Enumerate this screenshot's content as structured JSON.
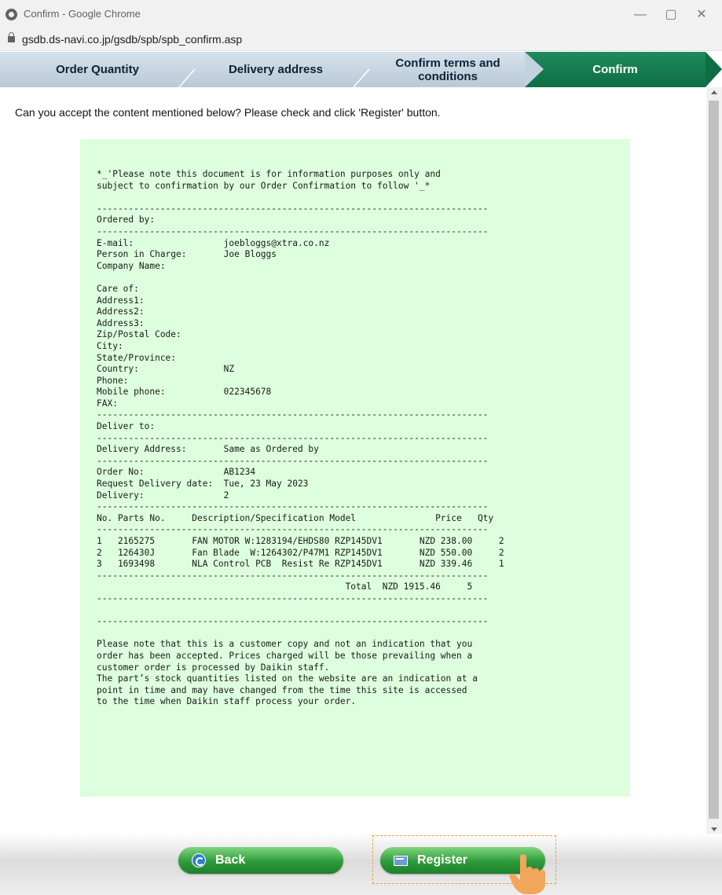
{
  "window": {
    "title": "Confirm - Google Chrome"
  },
  "address": {
    "url": "gsdb.ds-navi.co.jp/gsdb/spb/spb_confirm.asp"
  },
  "steps": [
    {
      "label": "Order Quantity"
    },
    {
      "label": "Delivery address"
    },
    {
      "label_line1": "Confirm terms and",
      "label_line2": "conditions"
    },
    {
      "label": "Confirm"
    }
  ],
  "page": {
    "prompt": "Can you accept the content mentioned below? Please check and click 'Register' button.",
    "document": "*_'Please note this document is for information purposes only and\nsubject to confirmation by our Order Confirmation to follow '_*\n\n--------------------------------------------------------------------------\nOrdered by:\n--------------------------------------------------------------------------\nE-mail:                 joebloggs@xtra.co.nz\nPerson in Charge:       Joe Bloggs\nCompany Name:\n\nCare of:\nAddress1:\nAddress2:\nAddress3:\nZip/Postal Code:\nCity:\nState/Province:\nCountry:                NZ\nPhone:\nMobile phone:           022345678\nFAX:\n--------------------------------------------------------------------------\nDeliver to:\n--------------------------------------------------------------------------\nDelivery Address:       Same as Ordered by\n--------------------------------------------------------------------------\nOrder No:               AB1234\nRequest Delivery date:  Tue, 23 May 2023\nDelivery:               2\n--------------------------------------------------------------------------\nNo. Parts No.     Description/Specification Model               Price   Qty\n--------------------------------------------------------------------------\n1   2165275       FAN MOTOR W:1283194/EHDS80 RZP145DV1       NZD 238.00     2\n2   126430J       Fan Blade  W:1264302/P47M1 RZP145DV1       NZD 550.00     2\n3   1693498       NLA Control PCB  Resist Re RZP145DV1       NZD 339.46     1\n--------------------------------------------------------------------------\n                                               Total  NZD 1915.46     5\n--------------------------------------------------------------------------\n\n--------------------------------------------------------------------------\n\nPlease note that this is a customer copy and not an indication that you\norder has been accepted. Prices charged will be those prevailing when a\ncustomer order is processed by Daikin staff.\nThe part’s stock quantities listed on the website are an indication at a\npoint in time and may have changed from the time this site is accessed\nto the time when Daikin staff process your order."
  },
  "buttons": {
    "back": "Back",
    "register": "Register"
  },
  "icons": {
    "browser": "chrome-icon",
    "lock": "lock-icon",
    "back": "back-arrow-icon",
    "register": "register-icon",
    "pointer": "hand-pointer-icon"
  },
  "colors": {
    "step_inactive": "#c7d6e2",
    "step_active": "#137a4f",
    "document_bg": "#ddffdd",
    "button_green": "#2e9b3a"
  }
}
